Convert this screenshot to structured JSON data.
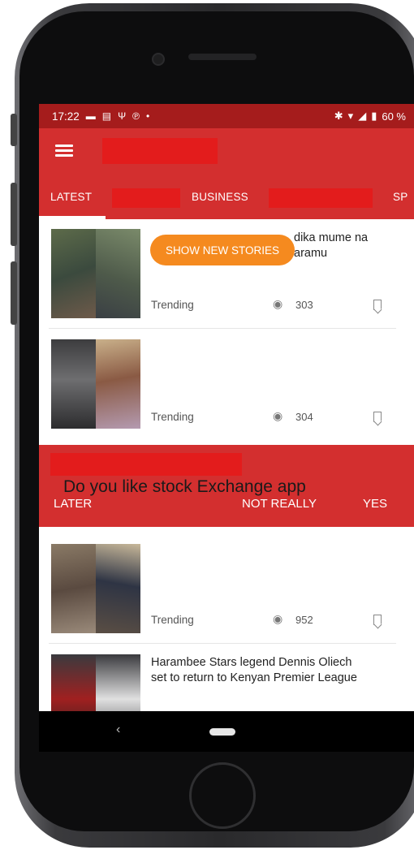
{
  "status_bar": {
    "time": "17:22",
    "battery": "60 %"
  },
  "tabs": [
    {
      "label": "LATEST"
    },
    {
      "label": "BUSINESS"
    },
    {
      "label": "SP"
    }
  ],
  "new_stories_button": "SHOW NEW STORIES",
  "articles": [
    {
      "headline": "N... ...dika mume na ...aramu",
      "line1": "dika mume na",
      "line2": "aramu",
      "category": "Trending",
      "views": "303"
    },
    {
      "headline": "",
      "category": "Trending",
      "views": "304"
    },
    {
      "headline": "",
      "category": "Trending",
      "views": "952"
    },
    {
      "line1": "Harambee Stars legend Dennis Oliech",
      "line2": "set to return to Kenyan Premier League"
    }
  ],
  "rating_prompt": {
    "question": "Do you like stock Exchange app",
    "later": "LATER",
    "not_really": "NOT REALLY",
    "yes": "YES"
  },
  "colors": {
    "accent": "#d32f2f",
    "status_bar": "#a51c1c",
    "pill": "#f58a1f"
  }
}
